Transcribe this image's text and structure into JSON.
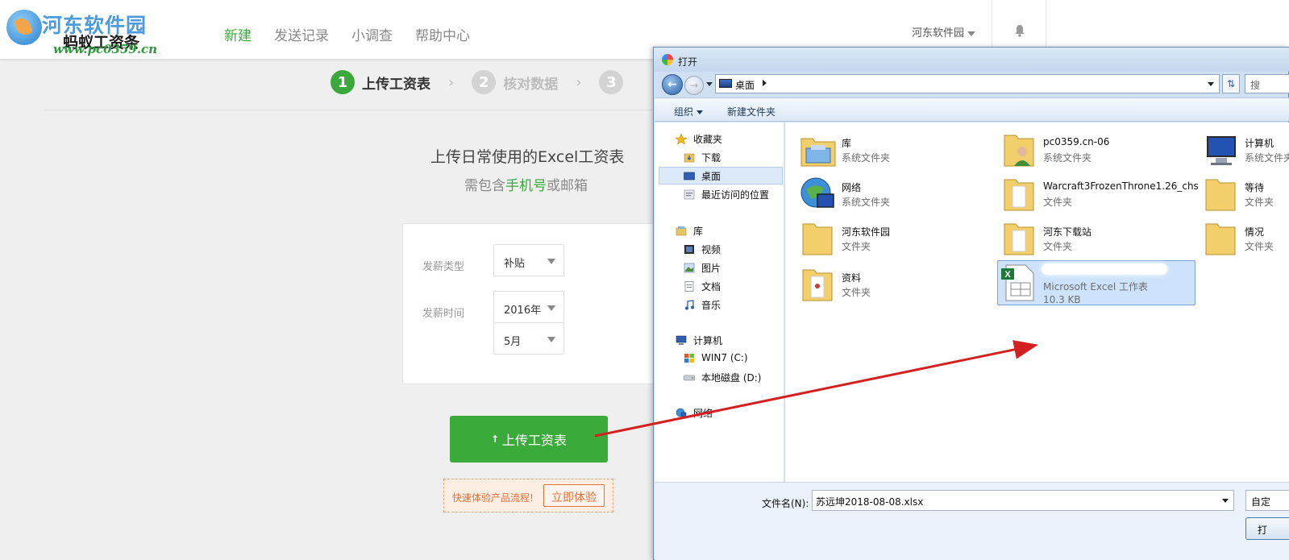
{
  "watermark": {
    "site": "河东软件园",
    "url": "www.pc0359.cn"
  },
  "brand": "蚂蚁工资条",
  "nav": {
    "items": [
      "新建",
      "发送记录",
      "小调查",
      "帮助中心"
    ],
    "active_index": 0
  },
  "user_menu": {
    "name": "河东软件园"
  },
  "steps": [
    {
      "num": "1",
      "label": "上传工资表",
      "active": true
    },
    {
      "num": "2",
      "label": "核对数据",
      "active": false
    },
    {
      "num": "3",
      "label": "",
      "active": false
    }
  ],
  "upload": {
    "title": "上传日常使用的Excel工资表",
    "sub_prefix": "需包含",
    "sub_highlight": "手机号",
    "sub_suffix": "或邮箱"
  },
  "form": {
    "salary_type_label": "发薪类型",
    "salary_type_value": "补贴",
    "salary_time_label": "发薪时间",
    "year_value": "2016年",
    "month_value": "5月"
  },
  "upload_button": {
    "icon": "↑",
    "label": "上传工资表"
  },
  "try_box": {
    "text": "快速体验产品流程!",
    "button": "立即体验"
  },
  "dialog": {
    "title": "打开",
    "address": "桌面",
    "search_placeholder": "搜",
    "toolbar": {
      "organize": "组织",
      "new_folder": "新建文件夹"
    },
    "nav_pane": {
      "favorites": "收藏夹",
      "downloads": "下载",
      "desktop": "桌面",
      "recent": "最近访问的位置",
      "libraries": "库",
      "videos": "视频",
      "pictures": "图片",
      "documents": "文档",
      "music": "音乐",
      "computer": "计算机",
      "drive_c": "WIN7 (C:)",
      "drive_d": "本地磁盘 (D:)",
      "network": "网络"
    },
    "files": [
      {
        "name": "库",
        "type": "系统文件夹"
      },
      {
        "name": "pc0359.cn-06",
        "type": "系统文件夹"
      },
      {
        "name": "计算机",
        "type": "系统文件夹"
      },
      {
        "name": "网络",
        "type": "系统文件夹"
      },
      {
        "name": "Warcraft3FrozenThrone1.26_chs",
        "type": "文件夹"
      },
      {
        "name": "等待",
        "type": "文件夹"
      },
      {
        "name": "河东软件园",
        "type": "文件夹"
      },
      {
        "name": "河东下载站",
        "type": "文件夹"
      },
      {
        "name": "情况",
        "type": "文件夹"
      },
      {
        "name": "资料",
        "type": "文件夹"
      },
      {
        "name": "Microsoft Excel 工作表",
        "type": "10.3 KB"
      }
    ],
    "filename_label": "文件名(N):",
    "filename_value": "苏远坤2018-08-08.xlsx",
    "filter_label": "自定",
    "open_button": "打"
  },
  "colors": {
    "accent_green": "#3aa83a",
    "orange": "#e4703a",
    "arrow_red": "#d32020"
  }
}
